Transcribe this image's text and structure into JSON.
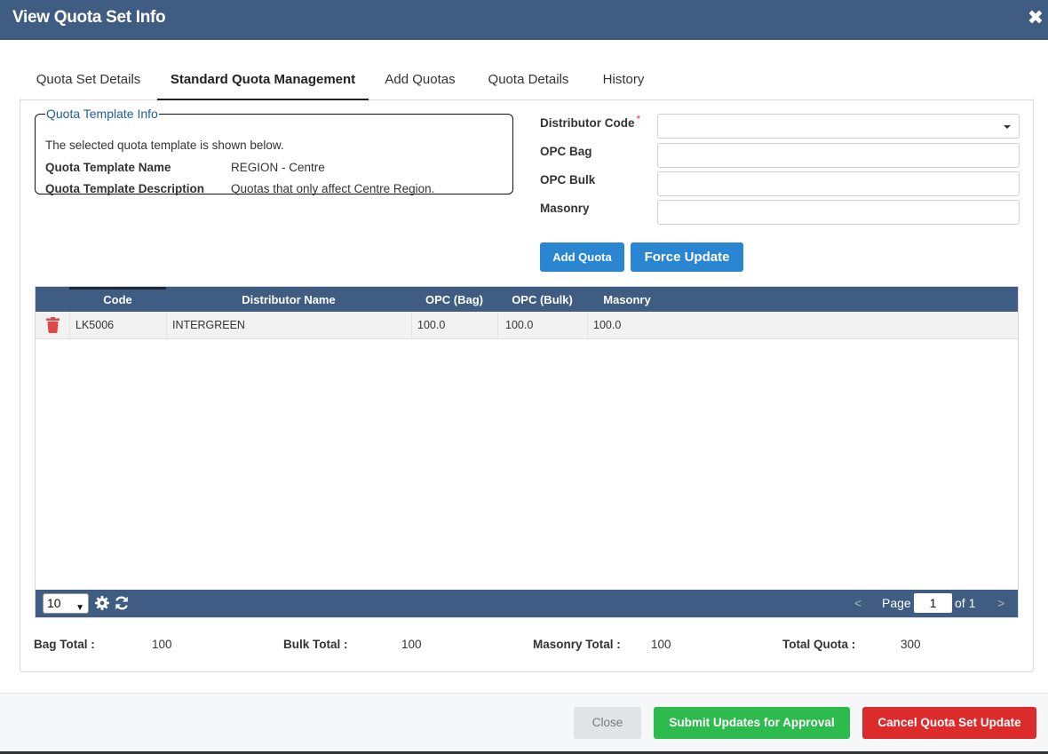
{
  "window": {
    "title": "View Quota Set Info",
    "close_glyph": "✖"
  },
  "tabs": [
    {
      "label": "Quota Set Details"
    },
    {
      "label": "Standard Quota Management"
    },
    {
      "label": "Add Quotas"
    },
    {
      "label": "Quota Details"
    },
    {
      "label": "History"
    }
  ],
  "active_tab": "Standard Quota Management",
  "template_info": {
    "legend": "Quota Template Info",
    "description": "The selected quota template is shown below.",
    "name_label": "Quota Template Name",
    "name_value": "REGION - Centre",
    "desc_label": "Quota Template Description",
    "desc_value": "Quotas that only affect Centre Region."
  },
  "form": {
    "distributor_code_label": "Distributor Code",
    "required_marker": "*",
    "distributor_code_value": "",
    "opc_bag_label": "OPC Bag",
    "opc_bag_value": "",
    "opc_bulk_label": "OPC Bulk",
    "opc_bulk_value": "",
    "masonry_label": "Masonry",
    "masonry_value": "",
    "add_quota_label": "Add Quota",
    "force_update_label": "Force Update"
  },
  "grid": {
    "columns": [
      "Code",
      "Distributor Name",
      "OPC (Bag)",
      "OPC (Bulk)",
      "Masonry"
    ],
    "rows": [
      {
        "code": "LK5006",
        "distributor_name": "INTERGREEN",
        "opc_bag": "100.0",
        "opc_bulk": "100.0",
        "masonry": "100.0"
      }
    ],
    "page_size": "10",
    "page_label": "Page",
    "page_value": "1",
    "of_label": "of 1",
    "prev_glyph": "<",
    "next_glyph": ">"
  },
  "totals": {
    "bag_label": "Bag Total :",
    "bag_value": "100",
    "bulk_label": "Bulk Total :",
    "bulk_value": "100",
    "masonry_label": "Masonry Total :",
    "masonry_value": "100",
    "total_label": "Total Quota :",
    "total_value": "300"
  },
  "footer": {
    "close_label": "Close",
    "submit_label": "Submit Updates for Approval",
    "cancel_label": "Cancel Quota Set Update"
  },
  "colors": {
    "header_bg": "#3f5c82",
    "accent_blue": "#2a86d1",
    "submit_green": "#2dbb4d",
    "cancel_red": "#dc2b2b",
    "delete_red": "#e04848",
    "legend_blue": "#1f5f99"
  },
  "icons": [
    "close-icon",
    "trash-icon",
    "caret-down-icon",
    "gear-icon",
    "refresh-icon"
  ]
}
